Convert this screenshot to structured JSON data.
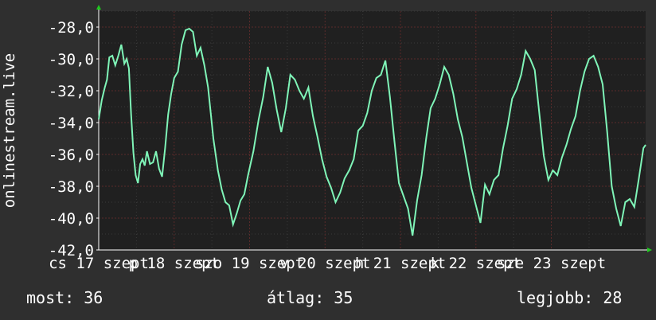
{
  "chart_data": {
    "type": "line",
    "title": "",
    "ylabel": "onlinestream.live",
    "xlabel": "",
    "ylim": [
      -42,
      -27
    ],
    "y_ticks": [
      -28,
      -30,
      -32,
      -34,
      -36,
      -38,
      -40,
      -42
    ],
    "y_tick_labels": [
      "-28,0",
      "-30,0",
      "-32,0",
      "-34,0",
      "-36,0",
      "-38,0",
      "-40,0",
      "-42,0"
    ],
    "x_range": [
      0,
      7.25
    ],
    "x_tick_labels": [
      {
        "x": 0.0,
        "label": "cs 17 szept"
      },
      {
        "x": 1.0,
        "label": "p 18 szept"
      },
      {
        "x": 2.0,
        "label": "szo 19 szept"
      },
      {
        "x": 3.0,
        "label": "v 20 szept"
      },
      {
        "x": 4.0,
        "label": "h 21 szept"
      },
      {
        "x": 5.0,
        "label": "k 22 szept"
      },
      {
        "x": 6.0,
        "label": "sze 23 szept"
      }
    ],
    "grid": true,
    "colors": {
      "line": "#7ff5b8",
      "background": "#202020",
      "grid": "#5a2a2a",
      "axis": "#ffffff",
      "arrow": "#1ec81e"
    },
    "series": [
      {
        "values": [
          [
            0.0,
            -33.8
          ],
          [
            0.04,
            -32.6
          ],
          [
            0.08,
            -31.8
          ],
          [
            0.11,
            -31.3
          ],
          [
            0.14,
            -29.9
          ],
          [
            0.18,
            -29.8
          ],
          [
            0.22,
            -30.4
          ],
          [
            0.26,
            -29.8
          ],
          [
            0.3,
            -29.1
          ],
          [
            0.34,
            -30.3
          ],
          [
            0.37,
            -30.0
          ],
          [
            0.4,
            -30.6
          ],
          [
            0.43,
            -33.5
          ],
          [
            0.46,
            -35.9
          ],
          [
            0.49,
            -37.3
          ],
          [
            0.52,
            -37.8
          ],
          [
            0.55,
            -36.6
          ],
          [
            0.58,
            -36.3
          ],
          [
            0.61,
            -36.7
          ],
          [
            0.64,
            -35.8
          ],
          [
            0.68,
            -36.6
          ],
          [
            0.72,
            -36.5
          ],
          [
            0.76,
            -35.8
          ],
          [
            0.8,
            -36.9
          ],
          [
            0.84,
            -37.4
          ],
          [
            0.88,
            -35.6
          ],
          [
            0.92,
            -33.5
          ],
          [
            0.96,
            -32.2
          ],
          [
            1.0,
            -31.2
          ],
          [
            1.05,
            -30.8
          ],
          [
            1.1,
            -29.1
          ],
          [
            1.15,
            -28.2
          ],
          [
            1.2,
            -28.1
          ],
          [
            1.25,
            -28.3
          ],
          [
            1.3,
            -29.8
          ],
          [
            1.35,
            -29.3
          ],
          [
            1.4,
            -30.4
          ],
          [
            1.45,
            -31.8
          ],
          [
            1.52,
            -35.0
          ],
          [
            1.58,
            -37.0
          ],
          [
            1.63,
            -38.2
          ],
          [
            1.68,
            -39.0
          ],
          [
            1.73,
            -39.2
          ],
          [
            1.78,
            -40.4
          ],
          [
            1.83,
            -39.7
          ],
          [
            1.88,
            -38.9
          ],
          [
            1.93,
            -38.5
          ],
          [
            1.98,
            -37.3
          ],
          [
            2.05,
            -35.8
          ],
          [
            2.12,
            -33.8
          ],
          [
            2.18,
            -32.4
          ],
          [
            2.24,
            -30.5
          ],
          [
            2.3,
            -31.5
          ],
          [
            2.36,
            -33.2
          ],
          [
            2.42,
            -34.6
          ],
          [
            2.48,
            -33.1
          ],
          [
            2.54,
            -31.0
          ],
          [
            2.6,
            -31.3
          ],
          [
            2.66,
            -32.0
          ],
          [
            2.72,
            -32.5
          ],
          [
            2.78,
            -31.8
          ],
          [
            2.84,
            -33.6
          ],
          [
            2.9,
            -34.9
          ],
          [
            2.96,
            -36.3
          ],
          [
            3.02,
            -37.4
          ],
          [
            3.08,
            -38.1
          ],
          [
            3.14,
            -39.0
          ],
          [
            3.2,
            -38.4
          ],
          [
            3.26,
            -37.5
          ],
          [
            3.32,
            -37.0
          ],
          [
            3.38,
            -36.3
          ],
          [
            3.44,
            -34.5
          ],
          [
            3.5,
            -34.2
          ],
          [
            3.56,
            -33.4
          ],
          [
            3.62,
            -32.0
          ],
          [
            3.68,
            -31.2
          ],
          [
            3.74,
            -31.0
          ],
          [
            3.8,
            -30.1
          ],
          [
            3.86,
            -32.4
          ],
          [
            3.92,
            -35.2
          ],
          [
            3.98,
            -37.8
          ],
          [
            4.04,
            -38.6
          ],
          [
            4.1,
            -39.4
          ],
          [
            4.16,
            -41.1
          ],
          [
            4.22,
            -38.9
          ],
          [
            4.28,
            -37.3
          ],
          [
            4.34,
            -35.0
          ],
          [
            4.4,
            -33.1
          ],
          [
            4.46,
            -32.5
          ],
          [
            4.52,
            -31.6
          ],
          [
            4.58,
            -30.5
          ],
          [
            4.64,
            -31.0
          ],
          [
            4.7,
            -32.2
          ],
          [
            4.76,
            -33.8
          ],
          [
            4.82,
            -34.9
          ],
          [
            4.88,
            -36.5
          ],
          [
            4.94,
            -38.1
          ],
          [
            5.0,
            -39.2
          ],
          [
            5.06,
            -40.3
          ],
          [
            5.12,
            -37.9
          ],
          [
            5.18,
            -38.5
          ],
          [
            5.24,
            -37.6
          ],
          [
            5.3,
            -37.3
          ],
          [
            5.36,
            -35.6
          ],
          [
            5.42,
            -34.2
          ],
          [
            5.48,
            -32.5
          ],
          [
            5.54,
            -31.9
          ],
          [
            5.6,
            -31.0
          ],
          [
            5.66,
            -29.5
          ],
          [
            5.72,
            -30.0
          ],
          [
            5.78,
            -30.7
          ],
          [
            5.84,
            -33.4
          ],
          [
            5.9,
            -36.1
          ],
          [
            5.96,
            -37.6
          ],
          [
            6.02,
            -37.0
          ],
          [
            6.08,
            -37.3
          ],
          [
            6.14,
            -36.2
          ],
          [
            6.2,
            -35.4
          ],
          [
            6.26,
            -34.4
          ],
          [
            6.32,
            -33.6
          ],
          [
            6.38,
            -32.0
          ],
          [
            6.44,
            -30.8
          ],
          [
            6.5,
            -30.0
          ],
          [
            6.56,
            -29.8
          ],
          [
            6.62,
            -30.5
          ],
          [
            6.68,
            -31.6
          ],
          [
            6.74,
            -34.6
          ],
          [
            6.8,
            -38.0
          ],
          [
            6.86,
            -39.4
          ],
          [
            6.92,
            -40.5
          ],
          [
            6.98,
            -39.0
          ],
          [
            7.04,
            -38.8
          ],
          [
            7.1,
            -39.3
          ],
          [
            7.16,
            -37.5
          ],
          [
            7.22,
            -35.6
          ],
          [
            7.25,
            -35.4
          ]
        ]
      }
    ]
  },
  "footer": {
    "current_label": "most: 36",
    "average_label": "átlag: 35",
    "best_label": "legjobb: 28"
  }
}
